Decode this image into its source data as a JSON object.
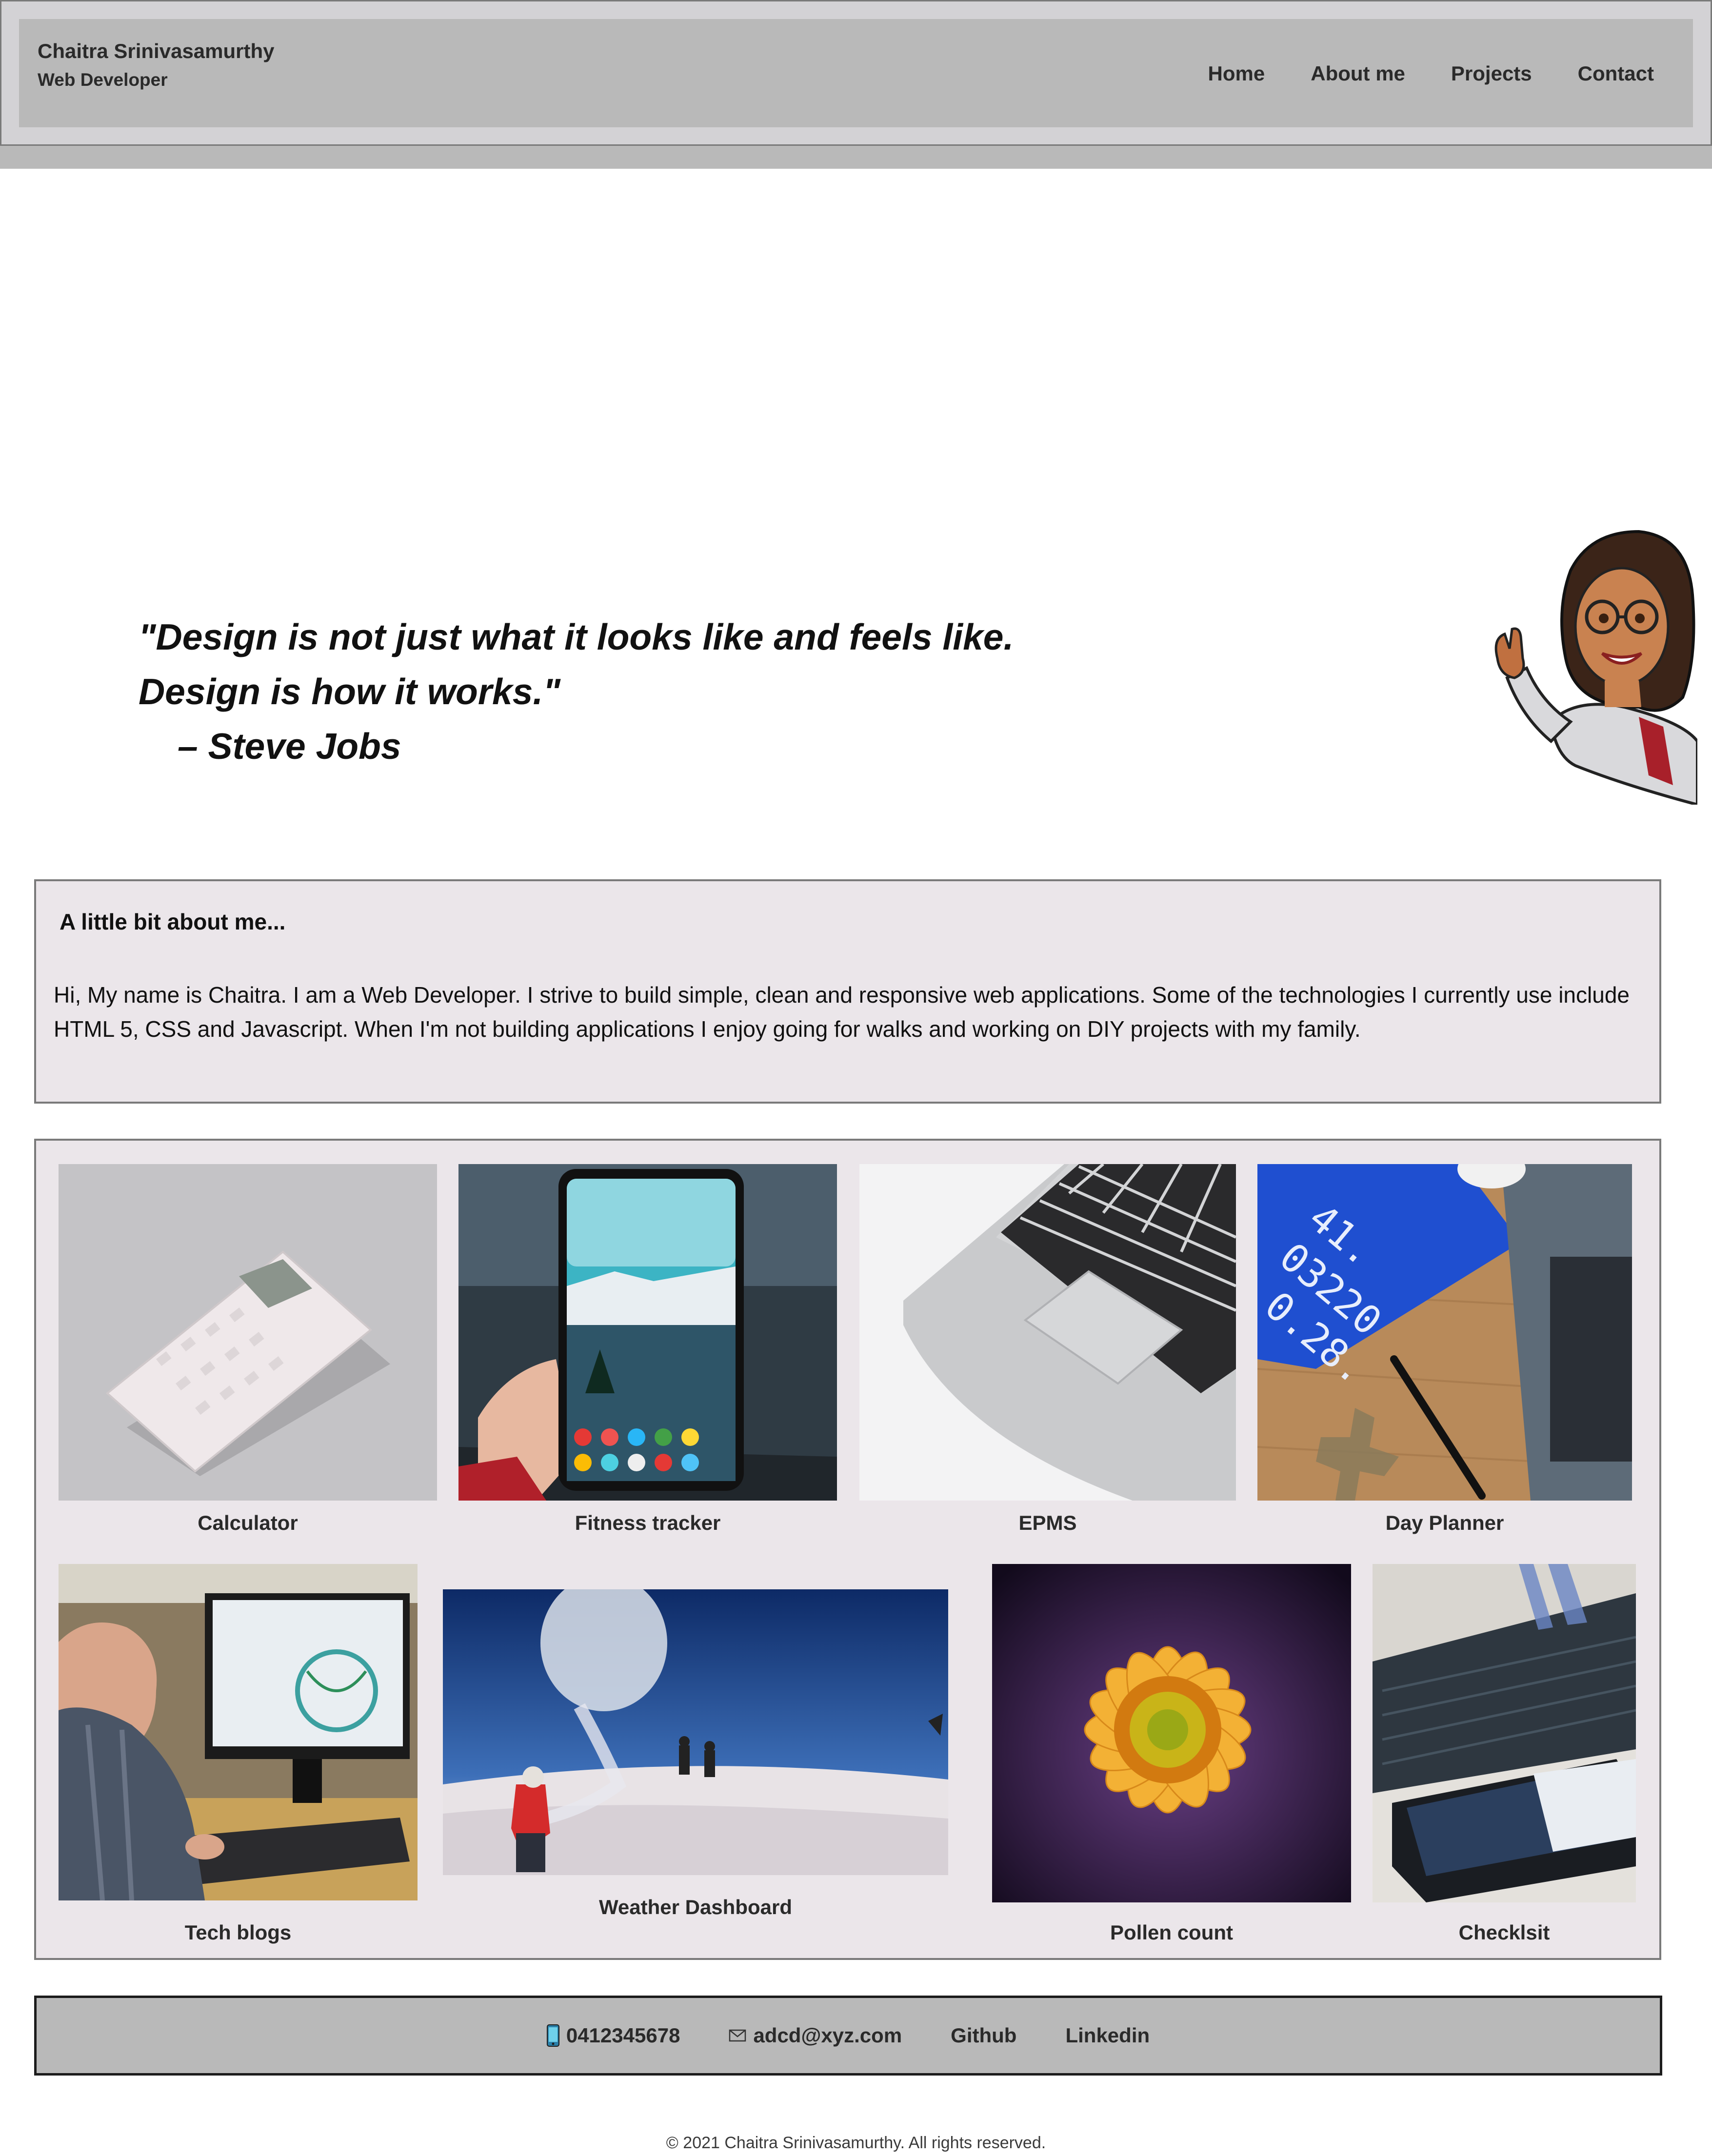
{
  "header": {
    "name": "Chaitra Srinivasamurthy",
    "role": "Web Developer",
    "nav": [
      "Home",
      "About me",
      "Projects",
      "Contact"
    ]
  },
  "hero": {
    "quote_line1": "\"Design is not just what it looks like and feels like.",
    "quote_line2": "Design is how it works.\"",
    "quote_author": "– Steve Jobs"
  },
  "about": {
    "title": "A little bit about me...",
    "text": "Hi, My name is Chaitra. I am a Web Developer. I strive to build simple, clean and responsive web applications. Some of the technologies I currently use include HTML 5, CSS and Javascript. When I'm not building applications I enjoy going for walks and working on DIY projects with my family."
  },
  "projects": [
    {
      "label": "Calculator",
      "image": "calculator-photo"
    },
    {
      "label": "Fitness tracker",
      "image": "smartphone-photo"
    },
    {
      "label": "EPMS",
      "image": "laptop-photo"
    },
    {
      "label": "Day Planner",
      "image": "notebook-desk-photo"
    },
    {
      "label": "Tech blogs",
      "image": "man-at-computer-photo"
    },
    {
      "label": "Weather Dashboard",
      "image": "weather-balloon-photo"
    },
    {
      "label": "Pollen count",
      "image": "sunflower-photo"
    },
    {
      "label": "Checklsit",
      "image": "phone-and-laptop-photo"
    }
  ],
  "footer": {
    "phone": "0412345678",
    "email": "adcd@xyz.com",
    "github": "Github",
    "linkedin": "Linkedin",
    "copyright": "© 2021 Chaitra Srinivasamurthy. All rights reserved."
  },
  "colors": {
    "header_band": "#b9b9b9",
    "panel_bg": "#ebe6ea",
    "border": "#7a7a7a"
  }
}
